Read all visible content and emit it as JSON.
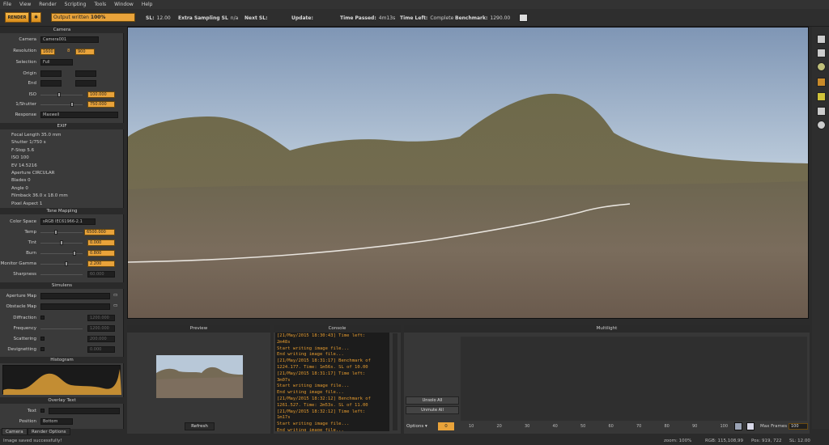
{
  "menu": [
    "File",
    "View",
    "Render",
    "Scripting",
    "Tools",
    "Window",
    "Help"
  ],
  "toolbar": {
    "render_label": "RENDER",
    "progress_label": "Output written ",
    "progress_value": "100%",
    "progress_fraction": 1.0,
    "sl_label": "SL:",
    "sl_value": "12.00",
    "extra_label": "Extra Sampling SL",
    "extra_value": "n/a",
    "next_label": "Next SL:",
    "update_label": "Update:",
    "time_passed_label": "Time Passed:",
    "time_passed_value": "4m13s",
    "time_left_label": "Time Left:",
    "time_left_value": "Complete",
    "benchmark_label": "Benchmark:",
    "benchmark_value": "1290.00"
  },
  "left": {
    "camera_header": "Camera",
    "camera_label": "Camera",
    "camera_value": "Camera001",
    "resolution_label": "Resolution",
    "res_w": "1600",
    "res_h": "900",
    "selection_label": "Selection",
    "selection_value": "Full",
    "origin_label": "Origin",
    "end_label": "End",
    "iso_label": "ISO",
    "iso_value": "100.000",
    "shutter_label": "1/Shutter",
    "shutter_value": "750.000",
    "response_label": "Response",
    "response_value": "Maxwell",
    "exif_header": "EXIF",
    "exif": [
      "Focal Length 35.0 mm",
      "Shutter 1/750 s",
      "F-Stop 5.6",
      "ISO 100",
      "EV 14.5216",
      "Aperture CIRCULAR",
      "Blades 0",
      "Angle 0",
      "Filmback 36.0 x 18.0 mm",
      "Pixel Aspect 1"
    ],
    "tone_header": "Tone Mapping",
    "color_space_label": "Color Space",
    "color_space_value": "sRGB IEC61966-2.1",
    "temp_label": "Temp",
    "temp_value": "6500.000",
    "tint_label": "Tint",
    "tint_value": "0.000",
    "burn_label": "Burn",
    "burn_value": "0.800",
    "gamma_label": "Monitor Gamma",
    "gamma_value": "2.200",
    "sharpness_label": "Sharpness",
    "sharpness_value": "60.000",
    "simulens_header": "Simulens",
    "aperture_map_label": "Aperture Map",
    "obstacle_map_label": "Obstacle Map",
    "diffraction_label": "Diffraction",
    "diffraction_value": "1200.000",
    "frequency_label": "Frequency",
    "frequency_value": "1200.000",
    "scattering_label": "Scattering",
    "scattering_value": "200.000",
    "devignetting_label": "Devignetting",
    "devignetting_value": "0.000",
    "histogram_header": "Histogram",
    "overlay_header": "Overlay Text",
    "text_label": "Text",
    "position_label": "Position",
    "position_value": "Bottom",
    "tab_camera": "Camera",
    "tab_render": "Render Options"
  },
  "preview": {
    "header": "Preview",
    "refresh": "Refresh"
  },
  "console": {
    "header": "Console",
    "lines": "[21/May/2015 18:30:43] Time left:\n2m48s\nStart writing image file...\nEnd writing image file...\n[21/May/2015 18:31:17] Benchmark of\n1224.177. Time: 1m56s. SL of 10.00\n[21/May/2015 18:31:17] Time left:\n3m07s\nStart writing image file...\nEnd writing image file...\n[21/May/2015 18:32:12] Benchmark of\n1261.527. Time: 2m53s. SL of 11.00\n[21/May/2015 18:32:12] Time left:\n1m17s\nStart writing image file...\nEnd writing image file...\n[21/May/2015 18:33:34] Benchmark of"
  },
  "multilight": {
    "header": "Multilight",
    "unsolo": "Unsolo All",
    "unmute": "Unmute All",
    "options": "Options",
    "frame_value": "0",
    "ticks": [
      "10",
      "20",
      "30",
      "40",
      "50",
      "60",
      "70",
      "80",
      "90",
      "100"
    ],
    "max_frames_label": "Max Frames",
    "max_frames_value": "100"
  },
  "status": {
    "message": "Image saved successfully!",
    "zoom": "zoom: 100%",
    "rgb": "RGB: 115,108,99",
    "pos": "Pos: 919, 722",
    "sl": "SL: 12.00"
  },
  "colors": {
    "accent": "#e9a33a",
    "console_text": "#e39a2f"
  }
}
